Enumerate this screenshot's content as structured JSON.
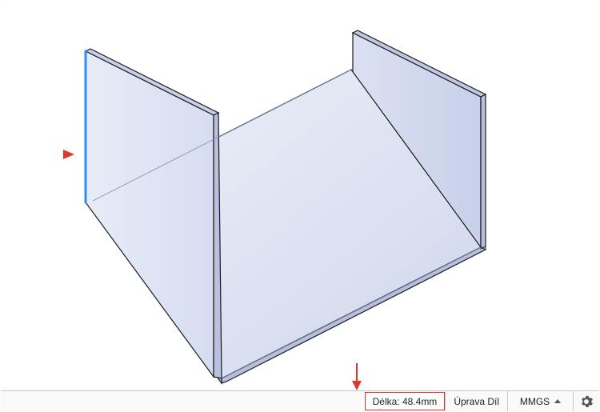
{
  "status": {
    "length_label": "Délka: 48.4mm",
    "edit_mode": "Úprava Díl",
    "units_label": "MMGS"
  },
  "viewport": {
    "selection_hint": "selected-edge"
  },
  "colors": {
    "face_light": "#e2e7f4",
    "face_mid": "#d2d9ee",
    "face_dark": "#c6cee8",
    "edge": "#1a1a1a",
    "selected_edge": "#2a8dff",
    "callout": "#e2332c"
  }
}
